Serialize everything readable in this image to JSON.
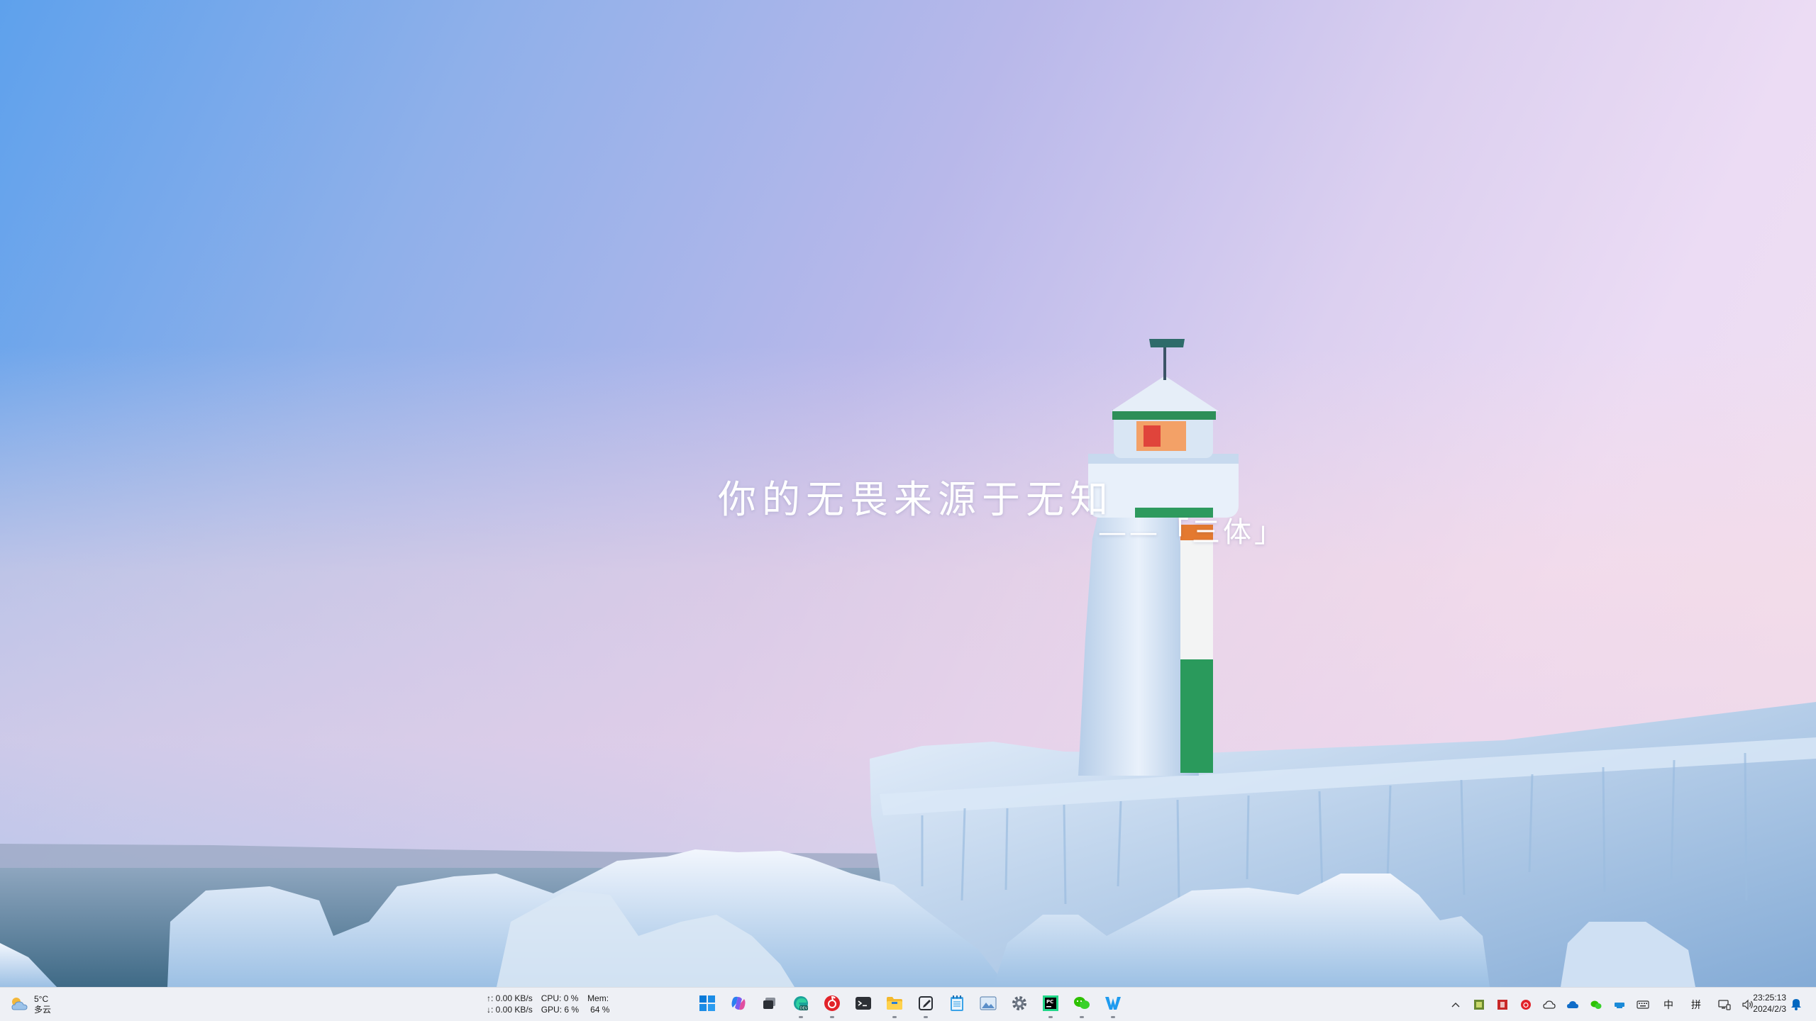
{
  "desktop": {
    "quote": "你的无畏来源于无知",
    "attribution": "——「三体」"
  },
  "taskbar": {
    "weather": {
      "temperature": "5°C",
      "condition": "多云",
      "icon": "partly-cloudy-icon"
    },
    "network": {
      "upload": "↑: 0.00 KB/s",
      "download": "↓: 0.00 KB/s"
    },
    "system": {
      "cpu": "CPU: 0 %",
      "gpu": "GPU: 6 %",
      "mem_label": "Mem:",
      "mem_value": "64 %"
    },
    "apps": [
      {
        "name": "start-button",
        "icon": "windows-logo-icon"
      },
      {
        "name": "copilot-app",
        "icon": "copilot-icon"
      },
      {
        "name": "task-view-app",
        "icon": "task-view-icon"
      },
      {
        "name": "edge-dev-app",
        "icon": "edge-dev-icon"
      },
      {
        "name": "netease-music-app",
        "icon": "netease-music-icon"
      },
      {
        "name": "terminal-app",
        "icon": "terminal-icon"
      },
      {
        "name": "file-explorer-app",
        "icon": "folder-icon"
      },
      {
        "name": "notes-app",
        "icon": "notes-icon"
      },
      {
        "name": "notepad-app",
        "icon": "notepad-icon"
      },
      {
        "name": "photos-app",
        "icon": "photos-icon"
      },
      {
        "name": "settings-app",
        "icon": "gear-icon"
      },
      {
        "name": "pycharm-app",
        "icon": "pycharm-icon"
      },
      {
        "name": "wechat-app",
        "icon": "wechat-icon"
      },
      {
        "name": "wps-app",
        "icon": "wps-icon"
      }
    ],
    "tray": {
      "ime_lang": "中",
      "ime_mode": "拼"
    },
    "clock": {
      "time": "23:25:13",
      "date": "2024/2/3"
    },
    "colors": {
      "accent": "#0067c0",
      "taskbar_bg": "#eef0f5"
    }
  }
}
